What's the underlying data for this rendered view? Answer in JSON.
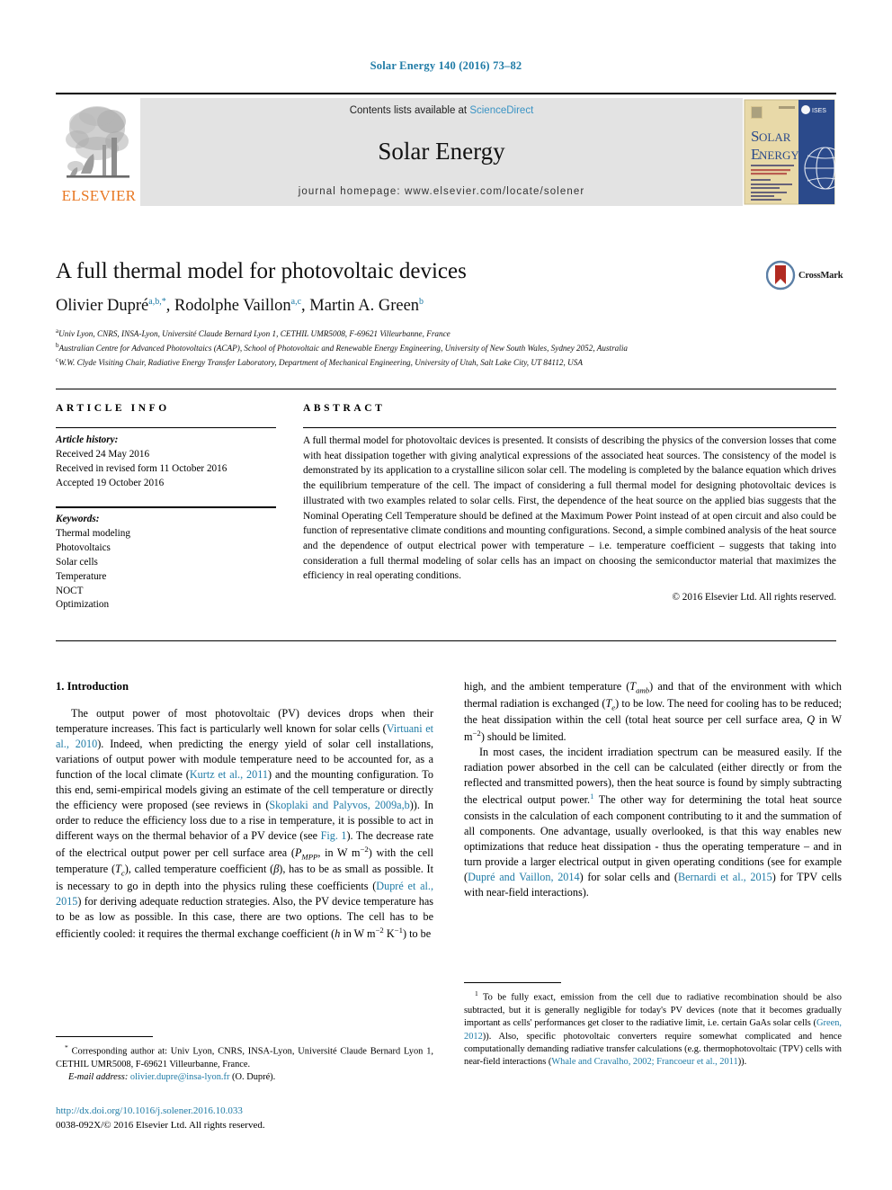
{
  "running_head": "Solar Energy 140 (2016) 73–82",
  "masthead": {
    "elsevier_wordmark": "ELSEVIER",
    "contents_prefix": "Contents lists available at ",
    "sciencedirect": "ScienceDirect",
    "journal_title": "Solar Energy",
    "homepage": "journal homepage: www.elsevier.com/locate/solener",
    "cover_title_line1": "SOLAR",
    "cover_title_line2": "ENERGY",
    "cover_badge": "ISES"
  },
  "article": {
    "title": "A full thermal model for photovoltaic devices",
    "crossmark_label": "CrossMark",
    "authors": [
      {
        "name": "Olivier Dupré",
        "marks": "a,b,*"
      },
      {
        "name": "Rodolphe Vaillon",
        "marks": "a,c"
      },
      {
        "name": "Martin A. Green",
        "marks": "b"
      }
    ],
    "affiliations": [
      {
        "mark": "a",
        "text": "Univ Lyon, CNRS, INSA-Lyon, Université Claude Bernard Lyon 1, CETHIL UMR5008, F-69621 Villeurbanne, France"
      },
      {
        "mark": "b",
        "text": "Australian Centre for Advanced Photovoltaics (ACAP), School of Photovoltaic and Renewable Energy Engineering, University of New South Wales, Sydney 2052, Australia"
      },
      {
        "mark": "c",
        "text": "W.W. Clyde Visiting Chair, Radiative Energy Transfer Laboratory, Department of Mechanical Engineering, University of Utah, Salt Lake City, UT 84112, USA"
      }
    ]
  },
  "article_info": {
    "heading": "ARTICLE INFO",
    "history_label": "Article history:",
    "history": [
      "Received 24 May 2016",
      "Received in revised form 11 October 2016",
      "Accepted 19 October 2016"
    ],
    "keywords_label": "Keywords:",
    "keywords": [
      "Thermal modeling",
      "Photovoltaics",
      "Solar cells",
      "Temperature",
      "NOCT",
      "Optimization"
    ]
  },
  "abstract": {
    "heading": "ABSTRACT",
    "body": "A full thermal model for photovoltaic devices is presented. It consists of describing the physics of the conversion losses that come with heat dissipation together with giving analytical expressions of the associated heat sources. The consistency of the model is demonstrated by its application to a crystalline silicon solar cell. The modeling is completed by the balance equation which drives the equilibrium temperature of the cell. The impact of considering a full thermal model for designing photovoltaic devices is illustrated with two examples related to solar cells. First, the dependence of the heat source on the applied bias suggests that the Nominal Operating Cell Temperature should be defined at the Maximum Power Point instead of at open circuit and also could be function of representative climate conditions and mounting configurations. Second, a simple combined analysis of the heat source and the dependence of output electrical power with temperature – i.e. temperature coefficient – suggests that taking into consideration a full thermal modeling of solar cells has an impact on choosing the semiconductor material that maximizes the efficiency in real operating conditions.",
    "copyright": "© 2016 Elsevier Ltd. All rights reserved."
  },
  "introduction": {
    "heading": "1. Introduction",
    "left_para_1_a": "The output power of most photovoltaic (PV) devices drops when their temperature increases. This fact is particularly well known for solar cells (",
    "left_ref_1": "Virtuani et al., 2010",
    "left_para_1_b": "). Indeed, when predicting the energy yield of solar cell installations, variations of output power with module temperature need to be accounted for, as a function of the local climate (",
    "left_ref_2": "Kurtz et al., 2011",
    "left_para_1_c": ") and the mounting configuration. To this end, semi-empirical models giving an estimate of the cell temperature or directly the efficiency were proposed (see reviews in (",
    "left_ref_3": "Skoplaki and Palyvos, 2009a,b",
    "left_para_1_d": ")). In order to reduce the efficiency loss due to a rise in temperature, it is possible to act in different ways on the thermal behavior of a PV device (see ",
    "left_ref_4": "Fig. 1",
    "left_para_1_e": "). The decrease rate of the electrical output power per cell surface area (",
    "left_para_1_f": ") with the cell temperature (",
    "left_para_1_g": "), called temperature coefficient (",
    "left_para_1_h": "), has to be as small as possible. It is necessary to go in depth into the physics ruling these coefficients (",
    "left_ref_5": "Dupré et al., 2015",
    "left_para_1_i": ") for deriving adequate reduction strategies. Also, the PV device temperature has to be as low as possible. In this case, there are two options. The cell has to be efficiently cooled: it requires the thermal exchange coefficient (",
    "left_para_1_j": ") to be",
    "right_para_1_a": "high, and the ambient temperature (",
    "right_para_1_b": ") and that of the environment with which thermal radiation is exchanged (",
    "right_para_1_c": ") to be low. The need for cooling has to be reduced; the heat dissipation within the cell (total heat source per cell surface area, ",
    "right_para_1_d": ") should be limited.",
    "right_para_2_a": "In most cases, the incident irradiation spectrum can be measured easily. If the radiation power absorbed in the cell can be calculated (either directly or from the reflected and transmitted powers), then the heat source is found by simply subtracting the electrical output power.",
    "right_fn_marker": "1",
    "right_para_2_b": " The other way for determining the total heat source consists in the calculation of each component contributing to it and the summation of all components. One advantage, usually overlooked, is that this way enables new optimizations that reduce heat dissipation - thus the operating temperature – and in turn provide a larger electrical output in given operating conditions (see for example (",
    "right_ref_1": "Dupré and Vaillon, 2014",
    "right_para_2_c": ") for solar cells and (",
    "right_ref_2": "Bernardi et al., 2015",
    "right_para_2_d": ") for TPV cells with near-field interactions)."
  },
  "math": {
    "pmpp": "P",
    "pmpp_sub": "MPP",
    "in_wm2": ", in W m",
    "exp_m2": "−2",
    "tc": "T",
    "tc_sub": "c",
    "beta": "β",
    "h": "h",
    "h_units_pre": " in W m",
    "h_exp1": "−2",
    "h_k": " K",
    "h_exp2": "−1",
    "tamb": "T",
    "tamb_sub": "amb",
    "te": "T",
    "te_sub": "e",
    "q": "Q",
    "q_units": " in W m",
    "q_exp": "−2"
  },
  "footnotes": {
    "corresponding_marker": "*",
    "corresponding": "Corresponding author at: Univ Lyon, CNRS, INSA-Lyon, Université Claude Bernard Lyon 1, CETHIL UMR5008, F-69621 Villeurbanne, France.",
    "email_label": "E-mail address:",
    "email": "olivier.dupre@insa-lyon.fr",
    "email_suffix": " (O. Dupré).",
    "doi": "http://dx.doi.org/10.1016/j.solener.2016.10.033",
    "issn_line": "0038-092X/© 2016 Elsevier Ltd. All rights reserved.",
    "right_marker": "1",
    "right_text_a": "To be fully exact, emission from the cell due to radiative recombination should be also subtracted, but it is generally negligible for today's PV devices (note that it becomes gradually important as cells' performances get closer to the radiative limit, i.e. certain GaAs solar cells (",
    "right_ref_green": "Green, 2012",
    "right_text_b": ")). Also, specific photovoltaic converters require somewhat complicated and hence computationally demanding radiative transfer calculations (e.g. thermophotovoltaic (TPV) cells with near-field interactions (",
    "right_ref_whale": "Whale and Cravalho, 2002; Francoeur et al., 2011",
    "right_text_c": "))."
  },
  "colors": {
    "link": "#1f7ba6",
    "elsevier_orange": "#e87722",
    "band_gray": "#e3e3e3",
    "cover_blue": "#2b4a8b",
    "cover_cream": "#e8d9a8"
  }
}
